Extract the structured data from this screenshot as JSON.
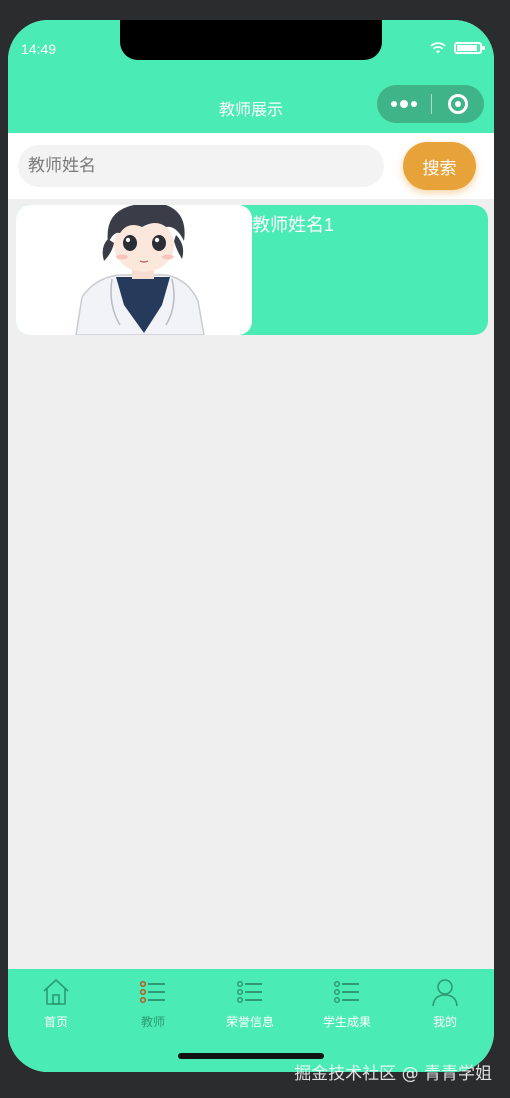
{
  "status": {
    "time": "14:49"
  },
  "header": {
    "title": "教师展示"
  },
  "search": {
    "placeholder": "教师姓名",
    "value": "",
    "button_label": "搜索"
  },
  "teachers": [
    {
      "name": "教师姓名1"
    }
  ],
  "tabbar": {
    "items": [
      {
        "label": "首页",
        "icon": "home-icon",
        "active": false
      },
      {
        "label": "教师",
        "icon": "list-icon",
        "active": true
      },
      {
        "label": "荣誉信息",
        "icon": "list-icon",
        "active": false
      },
      {
        "label": "学生成果",
        "icon": "list-icon",
        "active": false
      },
      {
        "label": "我的",
        "icon": "user-icon",
        "active": false
      }
    ]
  },
  "watermark": "掘金技术社区 @ 青青学姐",
  "colors": {
    "primary": "#4aebb5",
    "accent": "#e8a23a",
    "background": "#efefef",
    "active_tab": "#2e9a72"
  }
}
